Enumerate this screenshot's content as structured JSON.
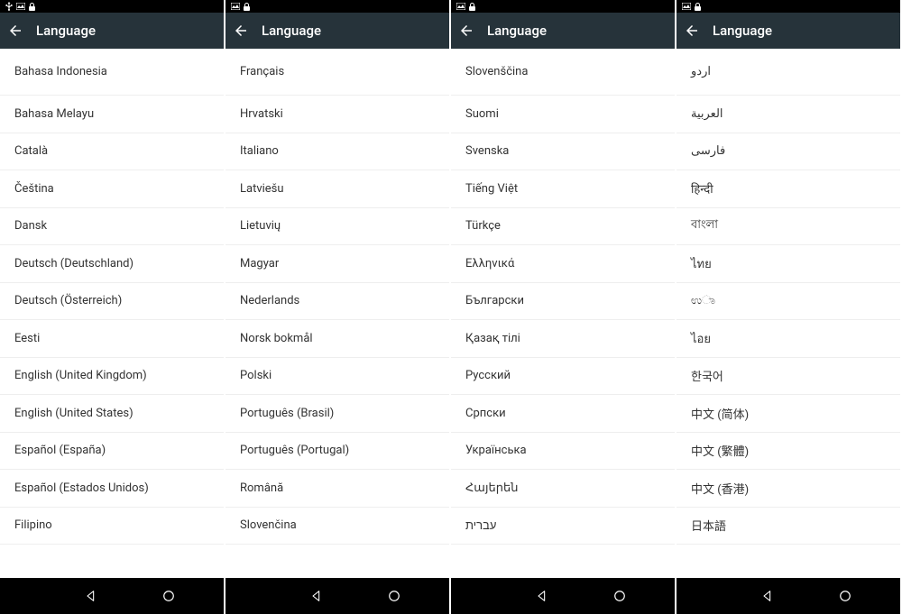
{
  "panels": [
    {
      "statusIcons": [
        "usb",
        "image",
        "lock"
      ],
      "title": "Language",
      "items": [
        "Bahasa Indonesia",
        "Bahasa Melayu",
        "Català",
        "Čeština",
        "Dansk",
        "Deutsch (Deutschland)",
        "Deutsch (Österreich)",
        "Eesti",
        "English (United Kingdom)",
        "English (United States)",
        "Español (España)",
        "Español (Estados Unidos)",
        "Filipino"
      ]
    },
    {
      "statusIcons": [
        "image",
        "lock"
      ],
      "title": "Language",
      "items": [
        "Français",
        "Hrvatski",
        "Italiano",
        "Latviešu",
        "Lietuvių",
        "Magyar",
        "Nederlands",
        "Norsk bokmål",
        "Polski",
        "Português (Brasil)",
        "Português (Portugal)",
        "Română",
        "Slovenčina"
      ]
    },
    {
      "statusIcons": [
        "image",
        "lock"
      ],
      "title": "Language",
      "items": [
        "Slovenščina",
        "Suomi",
        "Svenska",
        "Tiếng Việt",
        "Türkçe",
        "Ελληνικά",
        "Български",
        "Қазақ тілі",
        "Русский",
        "Српски",
        "Українська",
        "Հայերեն",
        "עברית"
      ]
    },
    {
      "statusIcons": [
        "image",
        "lock"
      ],
      "title": "Language",
      "items": [
        "اردو",
        "العربية",
        "فارسی",
        "हिन्दी",
        "বাংলা",
        "ไทย",
        "ಉಾ",
        "ไอย",
        "한국어",
        "中文 (简体)",
        "中文 (繁體)",
        "中文 (香港)",
        "日本語"
      ]
    }
  ]
}
